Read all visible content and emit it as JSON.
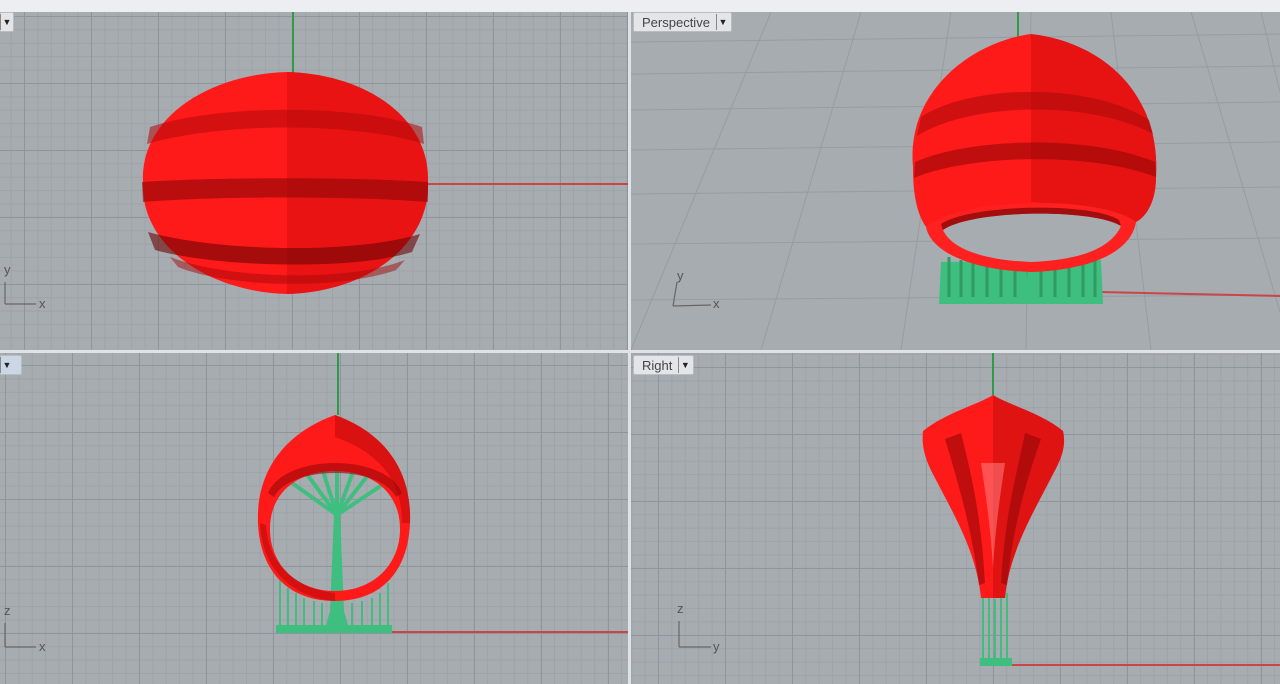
{
  "viewports": {
    "top": {
      "axis_v": "y",
      "axis_h": "x"
    },
    "perspective": {
      "title": "Perspective",
      "axis_v": "y",
      "axis_h": "x"
    },
    "front": {
      "axis_v": "z",
      "axis_h": "x"
    },
    "right": {
      "title": "Right",
      "axis_v": "z",
      "axis_h": "y"
    }
  },
  "icons": {
    "dropdown": "chevron-down-icon",
    "axis_widget": "axis-widget-icon"
  },
  "colors": {
    "model_red": "#ff1a1a",
    "support_green": "#3fbf7f",
    "axis_red": "#c8464a",
    "axis_green": "#2e9a4a",
    "grid_bg": "#a7acb1"
  }
}
